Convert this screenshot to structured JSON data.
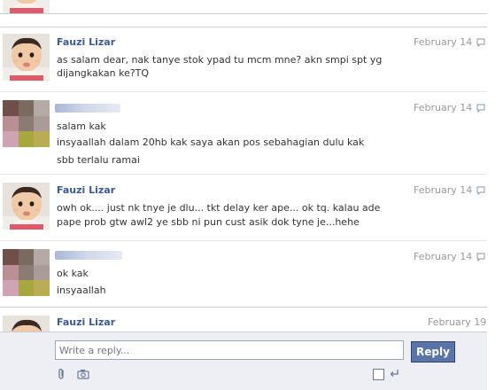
{
  "messages": [
    {
      "sender": "Fauzi Lizar",
      "date": "February 14",
      "avatar": "baby-photo",
      "lines": [
        "as salam dear, nak tanye stok ypad tu mcm mne? akn smpi spt yg",
        "dijangkakan ke?TQ"
      ]
    },
    {
      "sender": "",
      "date": "February 14",
      "avatar": "pixelated-photo",
      "lines": [
        "salam kak",
        "insyaallah dalam 20hb kak saya akan pos sebahagian dulu kak",
        "sbb terlalu ramai"
      ]
    },
    {
      "sender": "Fauzi Lizar",
      "date": "February 14",
      "avatar": "baby-photo",
      "lines": [
        "owh ok.... just nk tnye je dlu... tkt delay ker ape... ok tq. kalau ade",
        "pape prob gtw awl2 ye sbb ni pun cust asik dok tyne je...hehe"
      ]
    },
    {
      "sender": "",
      "date": "February 14",
      "avatar": "pixelated-photo",
      "lines": [
        "ok kak",
        "insyaallah"
      ]
    },
    {
      "sender": "Fauzi Lizar",
      "date": "February 19",
      "avatar": "baby-photo",
      "lines": []
    }
  ],
  "composer": {
    "placeholder": "Write a reply...",
    "reply_label": "Reply"
  },
  "colors": {
    "link_blue": "#3b5998",
    "button_blue": "#5b74a8",
    "composer_bg": "#edeff4"
  },
  "icons": [
    "reply-arrow-icon",
    "paperclip-icon",
    "camera-icon",
    "enter-arrow-icon"
  ]
}
